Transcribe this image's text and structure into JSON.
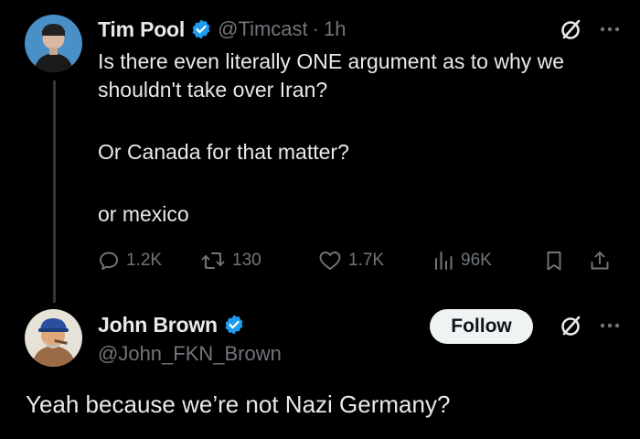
{
  "tweet": {
    "author_name": "Tim Pool",
    "author_handle": "@Timcast",
    "separator": "·",
    "time": "1h",
    "verified": true,
    "lines": [
      "Is there even literally ONE argument as to why we shouldn't take over Iran?",
      "Or Canada for that matter?",
      "or mexico"
    ],
    "stats": {
      "replies": "1.2K",
      "reposts": "130",
      "likes": "1.7K",
      "views": "96K"
    }
  },
  "reply": {
    "author_name": "John Brown",
    "author_handle": "@John_FKN_Brown",
    "verified": true,
    "follow_label": "Follow",
    "text": "Yeah because we’re not Nazi Germany?"
  },
  "colors": {
    "background": "#000000",
    "text_primary": "#e7e9ea",
    "text_secondary": "#71767b",
    "verified_blue": "#1d9bf0",
    "thread_line": "#333639",
    "follow_bg": "#eff3f4"
  },
  "icons": {
    "reply": "speech-bubble-icon",
    "repost": "repost-arrows-icon",
    "like": "heart-icon",
    "views": "bar-chart-icon",
    "bookmark": "bookmark-icon",
    "share": "share-upload-icon",
    "grok": "grok-slash-circle-icon",
    "more": "more-dots-icon",
    "verified": "verified-badge-icon"
  }
}
